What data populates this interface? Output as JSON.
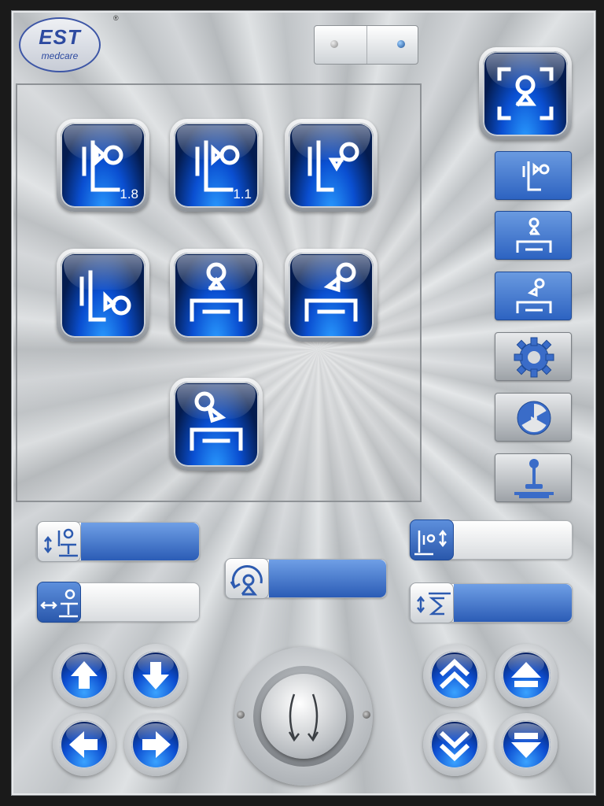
{
  "logo": {
    "brand": "EST",
    "subtitle": "medcare",
    "registered": "®"
  },
  "status_switch": {
    "left_state": "off",
    "right_state": "on"
  },
  "mode_buttons": [
    {
      "id": "wall-stand-1-8",
      "icon": "wall-stand-detector-icon",
      "label": "1.8"
    },
    {
      "id": "wall-stand-1-1",
      "icon": "wall-stand-detector-icon",
      "label": "1.1"
    },
    {
      "id": "wall-stand-angled",
      "icon": "wall-stand-angled-icon",
      "label": ""
    },
    {
      "id": "wall-stand-low",
      "icon": "wall-stand-low-icon",
      "label": ""
    },
    {
      "id": "table-vertical",
      "icon": "table-vertical-icon",
      "label": ""
    },
    {
      "id": "table-angled",
      "icon": "table-angled-icon",
      "label": ""
    },
    {
      "id": "table-oblique",
      "icon": "table-oblique-icon",
      "label": ""
    }
  ],
  "sidebar": {
    "items": [
      {
        "id": "exposure-frame",
        "icon": "exposure-frame-icon"
      },
      {
        "id": "wall-stand",
        "icon": "wall-stand-icon"
      },
      {
        "id": "table",
        "icon": "table-icon"
      },
      {
        "id": "table-angled",
        "icon": "table-angled-icon"
      },
      {
        "id": "settings",
        "icon": "gear-icon"
      },
      {
        "id": "radiation",
        "icon": "radiation-icon"
      },
      {
        "id": "joystick",
        "icon": "joystick-icon"
      }
    ]
  },
  "sliders": [
    {
      "id": "table-height",
      "icon": "table-height-icon",
      "level": 1.0
    },
    {
      "id": "table-lateral",
      "icon": "table-lateral-icon",
      "level": 0.0
    },
    {
      "id": "tube-rotation",
      "icon": "tube-rotation-icon",
      "level": 1.0
    },
    {
      "id": "wall-stand-height",
      "icon": "wall-stand-height-icon",
      "level": 0.0
    },
    {
      "id": "collimator",
      "icon": "collimator-icon",
      "level": 1.0
    }
  ],
  "direction_pad_left": [
    {
      "id": "up",
      "icon": "arrow-up-icon"
    },
    {
      "id": "down",
      "icon": "arrow-down-icon"
    },
    {
      "id": "left",
      "icon": "arrow-left-icon"
    },
    {
      "id": "right",
      "icon": "arrow-right-icon"
    }
  ],
  "direction_pad_right": [
    {
      "id": "fast-up",
      "icon": "double-chevron-up-icon"
    },
    {
      "id": "up",
      "icon": "triangle-up-bar-icon"
    },
    {
      "id": "fast-down",
      "icon": "double-chevron-down-icon"
    },
    {
      "id": "down",
      "icon": "triangle-down-bar-icon"
    }
  ],
  "colors": {
    "accent": "#0a4fd1",
    "slider_fill": "#3a6cc8",
    "panel": "#c8cbce"
  }
}
